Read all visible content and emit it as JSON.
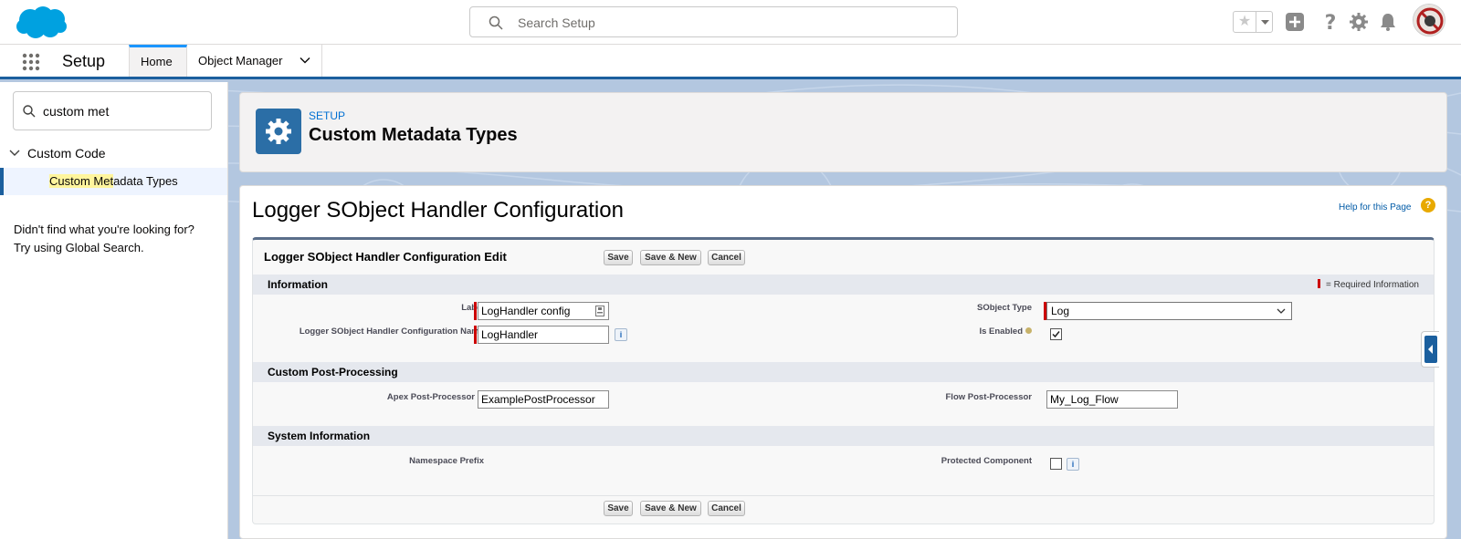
{
  "header": {
    "search_placeholder": "Search Setup",
    "icons": [
      "salesforce-cloud-logo",
      "search-icon",
      "star-icon",
      "chevron-down-icon",
      "add-icon",
      "help-icon",
      "gear-icon",
      "bell-icon"
    ]
  },
  "context_bar": {
    "app_name": "Setup",
    "tabs": [
      {
        "label": "Home",
        "active": true
      },
      {
        "label": "Object Manager",
        "active": false
      }
    ]
  },
  "sidebar": {
    "quickfind_value": "custom met",
    "tree_parent": "Custom Code",
    "tree_child_highlight": "Custom Met",
    "tree_child_rest": "adata Types",
    "nofind_line1": "Didn't find what you're looking for?",
    "nofind_line2": "Try using Global Search."
  },
  "setup_header": {
    "breadcrumb": "SETUP",
    "title": "Custom Metadata Types"
  },
  "page": {
    "title": "Logger SObject Handler Configuration",
    "help_link": "Help for this Page",
    "edit_title": "Logger SObject Handler Configuration Edit",
    "buttons": {
      "save": "Save",
      "save_new": "Save & New",
      "cancel": "Cancel"
    }
  },
  "sections": {
    "information": {
      "title": "Information",
      "required_legend": "= Required Information",
      "label_label": "Label",
      "label_value": "LogHandler config",
      "name_label": "Logger SObject Handler Configuration Name",
      "name_value": "LogHandler",
      "sobject_type_label": "SObject Type",
      "sobject_type_value": "Log",
      "is_enabled_label": "Is Enabled",
      "is_enabled_checked": true
    },
    "post_processing": {
      "title": "Custom Post-Processing",
      "apex_label": "Apex Post-Processor",
      "apex_value": "ExamplePostProcessor",
      "flow_label": "Flow Post-Processor",
      "flow_value": "My_Log_Flow"
    },
    "system": {
      "title": "System Information",
      "namespace_label": "Namespace Prefix",
      "protected_label": "Protected Component",
      "protected_checked": false
    }
  },
  "colors": {
    "brand_blue": "#1b5f9e",
    "link_blue": "#0070d2",
    "required_red": "#cc0000"
  }
}
